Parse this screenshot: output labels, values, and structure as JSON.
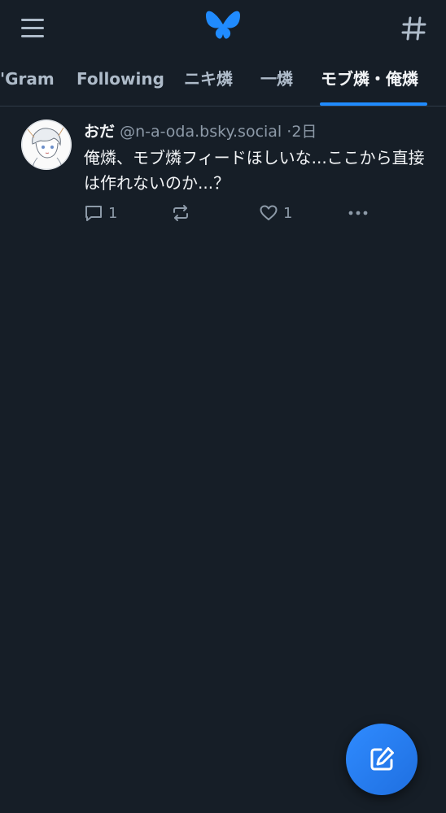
{
  "header": {
    "menu_icon": "hamburger-menu-icon",
    "logo_icon": "butterfly-logo-icon",
    "feeds_icon": "hashtag-icon",
    "brand_color": "#208bfe"
  },
  "tabs": [
    {
      "label": "'Gram"
    },
    {
      "label": "Following"
    },
    {
      "label": "ニキ燐"
    },
    {
      "label": "一燐"
    },
    {
      "label": "モブ燐・俺燐",
      "active": true
    }
  ],
  "post": {
    "display_name": "おだ",
    "handle": "@n-a-oda.bsky.social",
    "separator": "·",
    "time": "2日",
    "text": "俺燐、モブ燐フィードほしいな...ここから直接は作れないのか...？",
    "reply_count": "1",
    "repost_count": "",
    "like_count": "1"
  },
  "compose": {
    "icon": "compose-pencil-icon"
  }
}
